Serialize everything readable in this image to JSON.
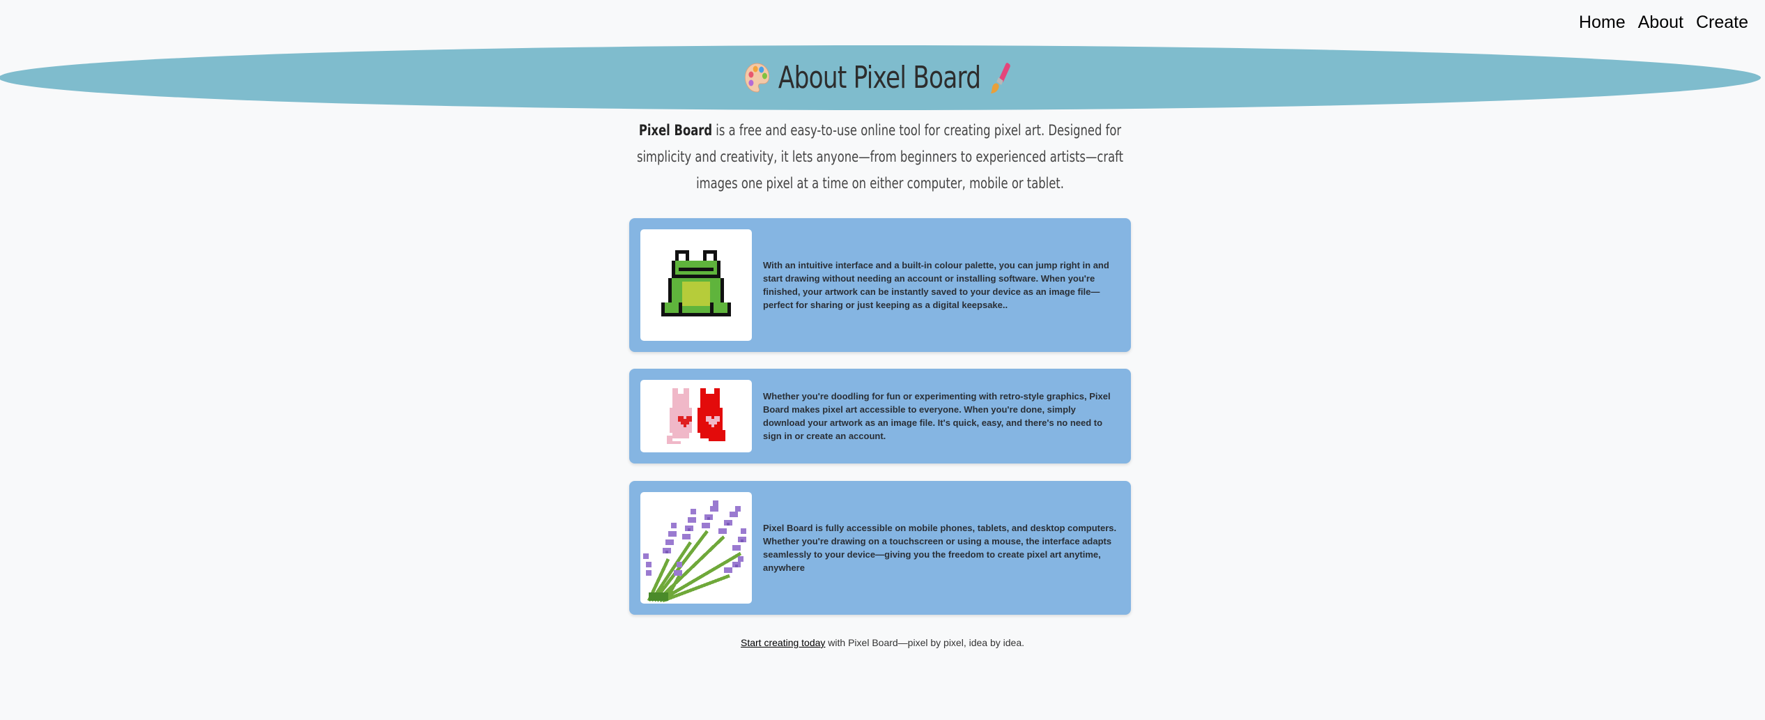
{
  "nav": {
    "items": [
      {
        "label": "Home"
      },
      {
        "label": "About"
      },
      {
        "label": "Create"
      }
    ]
  },
  "header": {
    "title": "About Pixel Board",
    "left_icon": "palette-icon",
    "right_icon": "paintbrush-icon",
    "background_color": "#7fbccd"
  },
  "intro": {
    "brand": "Pixel Board",
    "text": " is a free and easy-to-use online tool for creating pixel art. Designed for simplicity and creativity, it lets anyone—from beginners to experienced artists—craft images one pixel at a time on either computer, mobile or tablet."
  },
  "cards": [
    {
      "image": "frog-pixel-art",
      "text": "With an intuitive interface and a built-in colour palette, you can jump right in and start drawing without needing an account or installing software. When you're finished, your artwork can be instantly saved to your device as an image file—perfect for sharing or just keeping as a digital keepsake.."
    },
    {
      "image": "cats-pixel-art",
      "text": "Whether you're doodling for fun or experimenting with retro-style graphics, Pixel Board makes pixel art accessible to everyone. When you're done, simply download your artwork as an image file. It's quick, easy, and there's no need to sign in or create an account."
    },
    {
      "image": "lavender-pixel-art",
      "text": "Pixel Board is fully accessible on mobile phones, tablets, and desktop computers. Whether you're drawing on a touchscreen or using a mouse, the interface adapts seamlessly to your device—giving you the freedom to create pixel art anytime, anywhere"
    }
  ],
  "card_color": "#85b5e2",
  "footer": {
    "link_text": "Start creating today",
    "text": " with Pixel Board—pixel by pixel, idea by idea."
  }
}
